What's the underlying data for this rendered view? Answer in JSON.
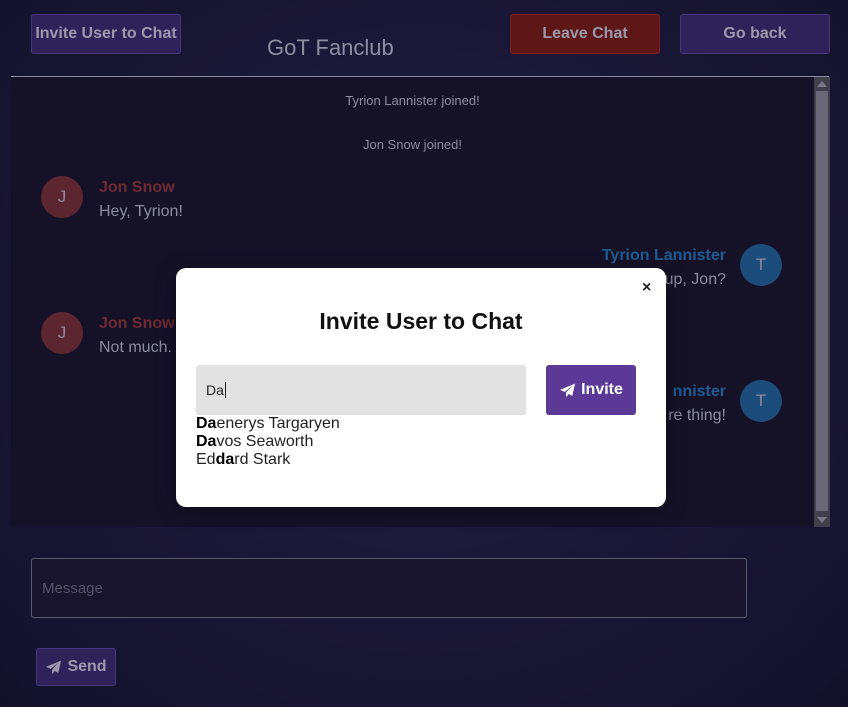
{
  "header": {
    "invite_label": "Invite User to Chat",
    "title": "GoT Fanclub",
    "leave_label": "Leave Chat",
    "back_label": "Go back"
  },
  "chat": {
    "system_messages": [
      "Tyrion Lannister joined!",
      "Jon Snow joined!"
    ],
    "messages": [
      {
        "initial": "J",
        "name": "Jon Snow",
        "text": "Hey, Tyrion!",
        "side": "left"
      },
      {
        "initial": "T",
        "name": "Tyrion Lannister",
        "text": "up, Jon?",
        "side": "right"
      },
      {
        "initial": "J",
        "name": "Jon Snow",
        "text": "Not much.",
        "side": "left"
      },
      {
        "initial": "T",
        "name": "nnister",
        "text": "re thing!",
        "side": "right"
      }
    ]
  },
  "composer": {
    "placeholder": "Message",
    "send_label": "Send"
  },
  "modal": {
    "title": "Invite User to Chat",
    "close_glyph": "×",
    "input_value": "Da",
    "invite_label": "Invite",
    "suggestions": [
      {
        "pre": "",
        "match": "Da",
        "post": "enerys Targaryen"
      },
      {
        "pre": "",
        "match": "Da",
        "post": "vos Seaworth"
      },
      {
        "pre": "Ed",
        "match": "da",
        "post": "rd Stark"
      }
    ]
  },
  "colors": {
    "accent_purple": "#5a3a96",
    "danger_red": "#5e1717",
    "jon_color": "#c0474f",
    "tyrion_color": "#2b86d8"
  },
  "icons": {
    "send": "paper-plane-icon",
    "invite": "paper-plane-icon",
    "close": "close-icon"
  }
}
